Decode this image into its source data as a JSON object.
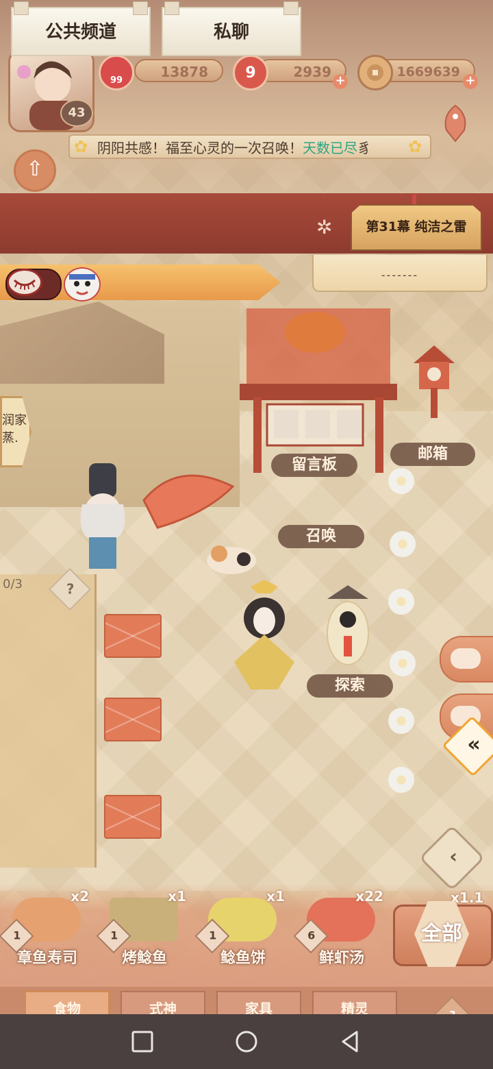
{
  "currencies": {
    "jade": {
      "value": "13878",
      "icon_name": "plum-blossom-icon",
      "badge": "99"
    },
    "stamina": {
      "value": "2939",
      "icon_name": "magatama-icon",
      "badge": "9"
    },
    "coins": {
      "value": "1669639",
      "icon_name": "coin-icon"
    }
  },
  "player": {
    "level": "43"
  },
  "announcement": {
    "prefix": "阴阳共感！福至心灵的一次召唤！",
    "highlight": "天数已尽",
    "suffix": "豸"
  },
  "tabs": {
    "public": "公共频道",
    "private": "私聊"
  },
  "scene_chapter": "第31幕 纯洁之雷",
  "panel_text": "-------",
  "map_labels": {
    "message_board": "留言板",
    "mailbox": "邮箱",
    "summon": "召唤",
    "explore": "探索"
  },
  "left_sign": "润家 蒸.",
  "quest_progress": "0/3",
  "help_mark": "?",
  "foods": [
    {
      "name": "章鱼寿司",
      "count": "x2",
      "level": "1",
      "color": "#e5a16f"
    },
    {
      "name": "烤鲶鱼",
      "count": "x1",
      "level": "1",
      "color": "#c9b07a"
    },
    {
      "name": "鲶鱼饼",
      "count": "x1",
      "level": "1",
      "color": "#e7d36b"
    },
    {
      "name": "鲜虾汤",
      "count": "x22",
      "level": "6",
      "color": "#e4715a"
    }
  ],
  "extra_count": "x1.1",
  "all_button": "全部",
  "categories": [
    "食物",
    "式神",
    "家具",
    "精灵"
  ],
  "colors": {
    "tab_bar": "#a74a3a",
    "accent_green": "#2aa583",
    "ribbon": "#f0b05c"
  }
}
